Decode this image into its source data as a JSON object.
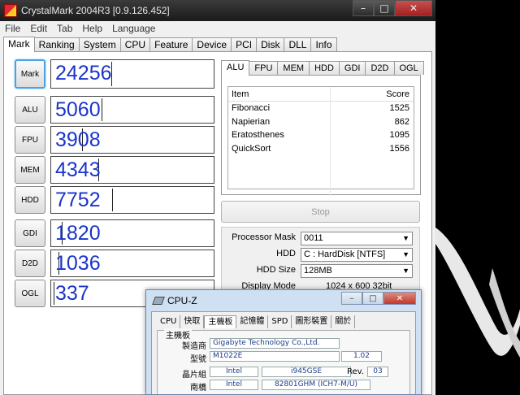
{
  "window": {
    "title": "CrystalMark 2004R3 [0.9.126.452]"
  },
  "menu": [
    "File",
    "Edit",
    "Tab",
    "Help",
    "Language"
  ],
  "main_tabs": [
    "Mark",
    "Ranking",
    "System",
    "CPU",
    "Feature",
    "Device",
    "PCI",
    "Disk",
    "DLL",
    "Info"
  ],
  "scores": [
    {
      "label": "Mark",
      "value": "24256",
      "fill_fraction": 0.37
    },
    {
      "label": "ALU",
      "value": "5060",
      "fill_fraction": 0.31
    },
    {
      "label": "FPU",
      "value": "3908",
      "fill_fraction": 0.19
    },
    {
      "label": "MEM",
      "value": "4343",
      "fill_fraction": 0.29
    },
    {
      "label": "HDD",
      "value": "7752",
      "fill_fraction": 0.38
    },
    {
      "label": "GDI",
      "value": "1820",
      "fill_fraction": 0.06
    },
    {
      "label": "D2D",
      "value": "1036",
      "fill_fraction": 0.04
    },
    {
      "label": "OGL",
      "value": "337",
      "fill_fraction": 0.01
    }
  ],
  "sub_tabs": [
    "ALU",
    "FPU",
    "MEM",
    "HDD",
    "GDI",
    "D2D",
    "OGL"
  ],
  "results_table": {
    "headers": [
      "Item",
      "Score"
    ],
    "rows": [
      [
        "Fibonacci",
        "1525"
      ],
      [
        "Napierian",
        "862"
      ],
      [
        "Eratosthenes",
        "1095"
      ],
      [
        "QuickSort",
        "1556"
      ]
    ]
  },
  "stop_button": "Stop",
  "settings": {
    "processor_mask_label": "Processor Mask",
    "processor_mask_value": "0011",
    "hdd_label": "HDD",
    "hdd_value": "C : HardDisk [NTFS]",
    "hdd_size_label": "HDD Size",
    "hdd_size_value": "128MB",
    "display_mode_label": "Display Mode",
    "display_mode_value": "1024 x 600 32bit"
  },
  "cpuz": {
    "title": "CPU-Z",
    "tabs": [
      "CPU",
      "快取",
      "主機板",
      "記憶體",
      "SPD",
      "圖形裝置",
      "關於"
    ],
    "group_label": "主機板",
    "manufacturer_label": "製造商",
    "manufacturer_value": "Gigabyte Technology Co.,Ltd.",
    "model_label": "型號",
    "model_value": "M1022E",
    "model_rev": "1.02",
    "chipset_label": "晶片組",
    "chipset_vendor": "Intel",
    "chipset_name": "i945GSE",
    "rev_label": "Rev.",
    "rev_value": "03",
    "southbridge_label": "南橋",
    "southbridge_vendor": "Intel",
    "southbridge_name": "82801GHM (ICH7-M/U)"
  },
  "colors": {
    "score_text": "#1a35c9",
    "focus_border": "#4aa3e0"
  }
}
